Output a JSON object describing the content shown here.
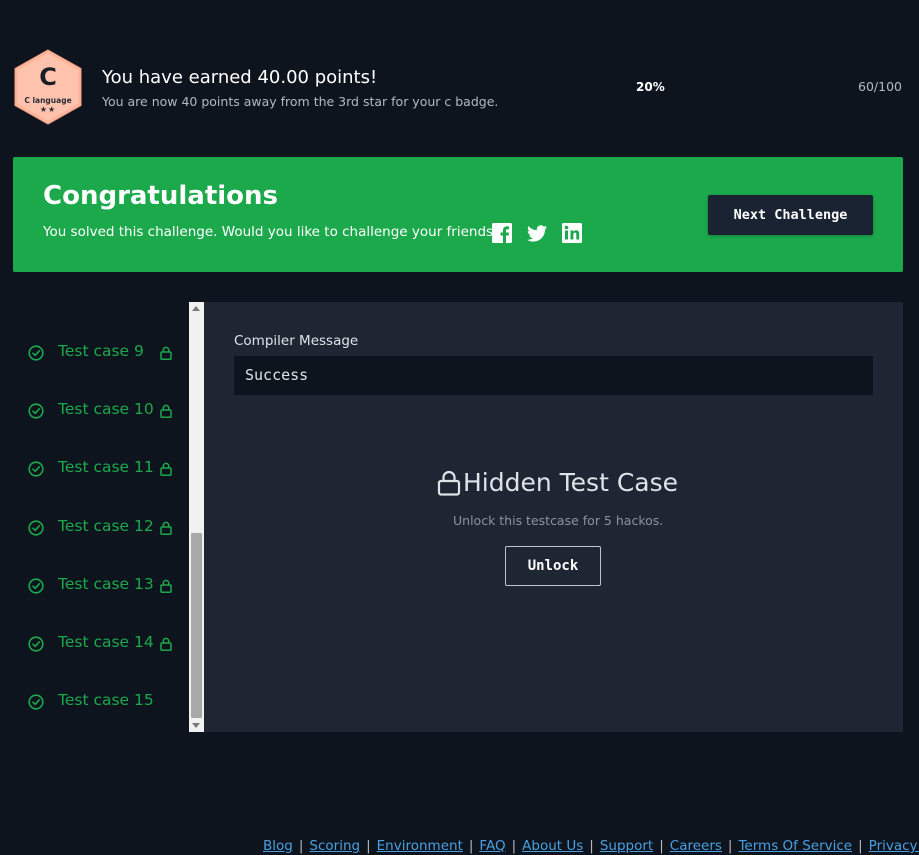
{
  "badge": {
    "letter": "C",
    "name": "C language",
    "stars": "★★",
    "color": "#ffb49a",
    "icon": "hexagon-badge-icon"
  },
  "progress": {
    "title": "You have earned 40.00 points!",
    "subtitle": "You are now 40 points away from the 3rd star for your c badge.",
    "percent_label": "20%",
    "score_label": "60/100",
    "percent_value": 0.2
  },
  "congrats": {
    "title": "Congratulations",
    "subtitle": "You solved this challenge. Would you like to challenge your friends?",
    "next_button": "Next Challenge",
    "social": [
      "facebook-icon",
      "twitter-icon",
      "linkedin-icon"
    ],
    "color": "#1ba94c"
  },
  "test_cases": [
    {
      "label": "Test case 9",
      "status": "passed",
      "locked": true
    },
    {
      "label": "Test case 10",
      "status": "passed",
      "locked": true
    },
    {
      "label": "Test case 11",
      "status": "passed",
      "locked": true
    },
    {
      "label": "Test case 12",
      "status": "passed",
      "locked": true
    },
    {
      "label": "Test case 13",
      "status": "passed",
      "locked": true
    },
    {
      "label": "Test case 14",
      "status": "passed",
      "locked": true
    },
    {
      "label": "Test case 15",
      "status": "passed",
      "locked": false
    }
  ],
  "compiler": {
    "label": "Compiler Message",
    "message": "Success"
  },
  "hidden_case": {
    "title": "Hidden Test Case",
    "subtitle": "Unlock this testcase for 5 hackos.",
    "unlock_button": "Unlock"
  },
  "footer": {
    "links": [
      "Blog",
      "Scoring",
      "Environment",
      "FAQ",
      "About Us",
      "Support",
      "Careers",
      "Terms Of Service",
      "Privacy P"
    ]
  }
}
